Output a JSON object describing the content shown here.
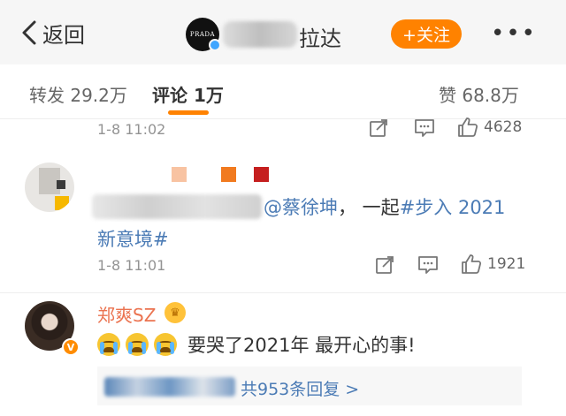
{
  "header": {
    "back_label": "返回",
    "avatar_text": "PRADA",
    "name_visible": "拉达",
    "follow_label": "+关注",
    "more_label": "•••"
  },
  "tabs": {
    "repost": "转发 29.2万",
    "comment": "评论 1万",
    "like": "赞 68.8万"
  },
  "comments": [
    {
      "time": "1-8 11:02",
      "like_count": "4628"
    },
    {
      "mention": "@蔡徐坤",
      "text_mid": "， 一起",
      "topic_part1": "#步入 2021",
      "topic_part2": "新意境#",
      "time": "1-8 11:01",
      "like_count": "1921",
      "square_colors": [
        "#f8c3a2",
        "#f17a1f",
        "#c51f1f"
      ]
    },
    {
      "name": "郑爽SZ",
      "text": "要哭了2021年 最开心的事!",
      "emoji_count": 3,
      "reply_summary": "共953条回复 >"
    }
  ],
  "colors": {
    "accent": "#ff8200",
    "link": "#4b7bb5",
    "name": "#eb7350"
  }
}
